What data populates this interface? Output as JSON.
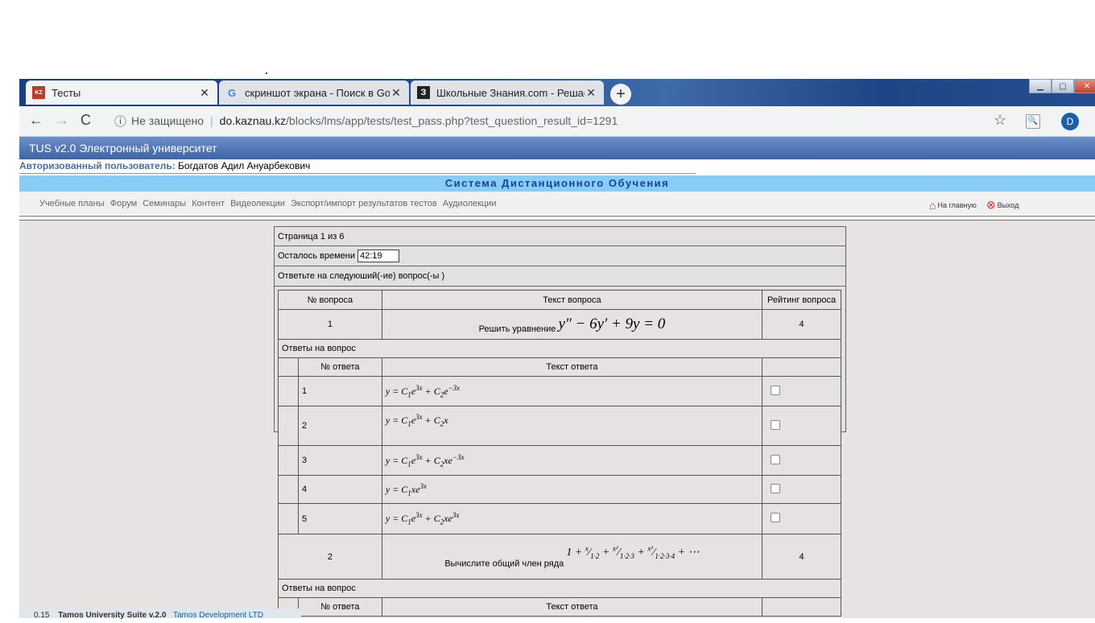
{
  "browser": {
    "tabs": [
      {
        "title": "Тесты",
        "icon": "kaznau-favicon-icon"
      },
      {
        "title": "скриншот экрана - Поиск в Goo",
        "icon": "google-icon"
      },
      {
        "title": "Школьные Знания.com - Решае",
        "icon": "znanija-icon"
      }
    ],
    "new_tab": "+",
    "insecure_label": "Не защищено",
    "url_host": "do.kaznau.kz",
    "url_path": "/blocks/lms/app/tests/test_pass.php?test_question_result_id=1291",
    "avatar_letter": "D"
  },
  "site": {
    "header_title": "TUS v2.0 Электронный университет",
    "user_label": "Авторизованный пользователь:",
    "user_name": "Богдатов Адил Ануарбекович",
    "system_title": "Система Дистанционного Обучения",
    "menu": [
      "Учебные планы",
      "Форум",
      "Семинары",
      "Контент",
      "Видеолекции",
      "Экспорт/импорт результатов тестов",
      "Аудиолекции"
    ],
    "home_label": "На главную",
    "exit_label": "Выход"
  },
  "test": {
    "page_info": "Страница 1 из 6",
    "time_left_label": "Осталось времени",
    "time_left_value": "42:19",
    "instruction": "Ответьте на следуюший(-ие) вопрос(-ы )",
    "col_question_num": "№ вопроса",
    "col_question_text": "Текст вопроса",
    "col_rating": "Рейтинг вопроса",
    "answers_label": "Ответы на вопрос",
    "col_answer_num": "№ ответа",
    "col_answer_text": "Текст ответа",
    "questions": [
      {
        "num": "1",
        "text": "Решить  уравнение",
        "formula": "y″ − 6y′ + 9y = 0",
        "rating": "4",
        "answers": [
          {
            "num": "1",
            "formula": "y = C1e3x + C2e−3x"
          },
          {
            "num": "2",
            "formula": "y = C1e3x + C2x"
          },
          {
            "num": "3",
            "formula": "y = C1e3x + C2xe−3x"
          },
          {
            "num": "4",
            "formula": "y = C1xe3x"
          },
          {
            "num": "5",
            "formula": "y = C1e3x + C2xe3x"
          }
        ]
      },
      {
        "num": "2",
        "text": "Вычислите общий член ряда",
        "formula": "1 + x/(1·2) + x²/(1·2·3) + x³/(1·2·3·4) + ⋯",
        "rating": "4"
      }
    ]
  },
  "footer": {
    "version_num": "0.15",
    "product": "Tamos University Suite v.2.0",
    "company": "Tamos Development LTD"
  }
}
